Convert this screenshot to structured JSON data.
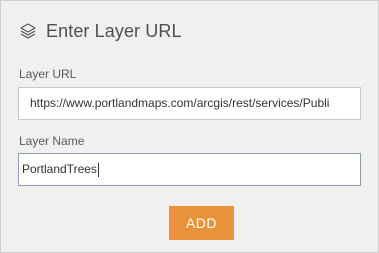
{
  "header": {
    "icon": "layers-icon",
    "title": "Enter Layer URL"
  },
  "form": {
    "url_label": "Layer URL",
    "url_value": "https://www.portlandmaps.com/arcgis/rest/services/Publi",
    "name_label": "Layer Name",
    "name_value": "PortlandTrees",
    "add_label": "ADD"
  },
  "colors": {
    "accent": "#e8923a",
    "panel_bg": "#f0f0f0",
    "text": "#4f4f4f"
  }
}
